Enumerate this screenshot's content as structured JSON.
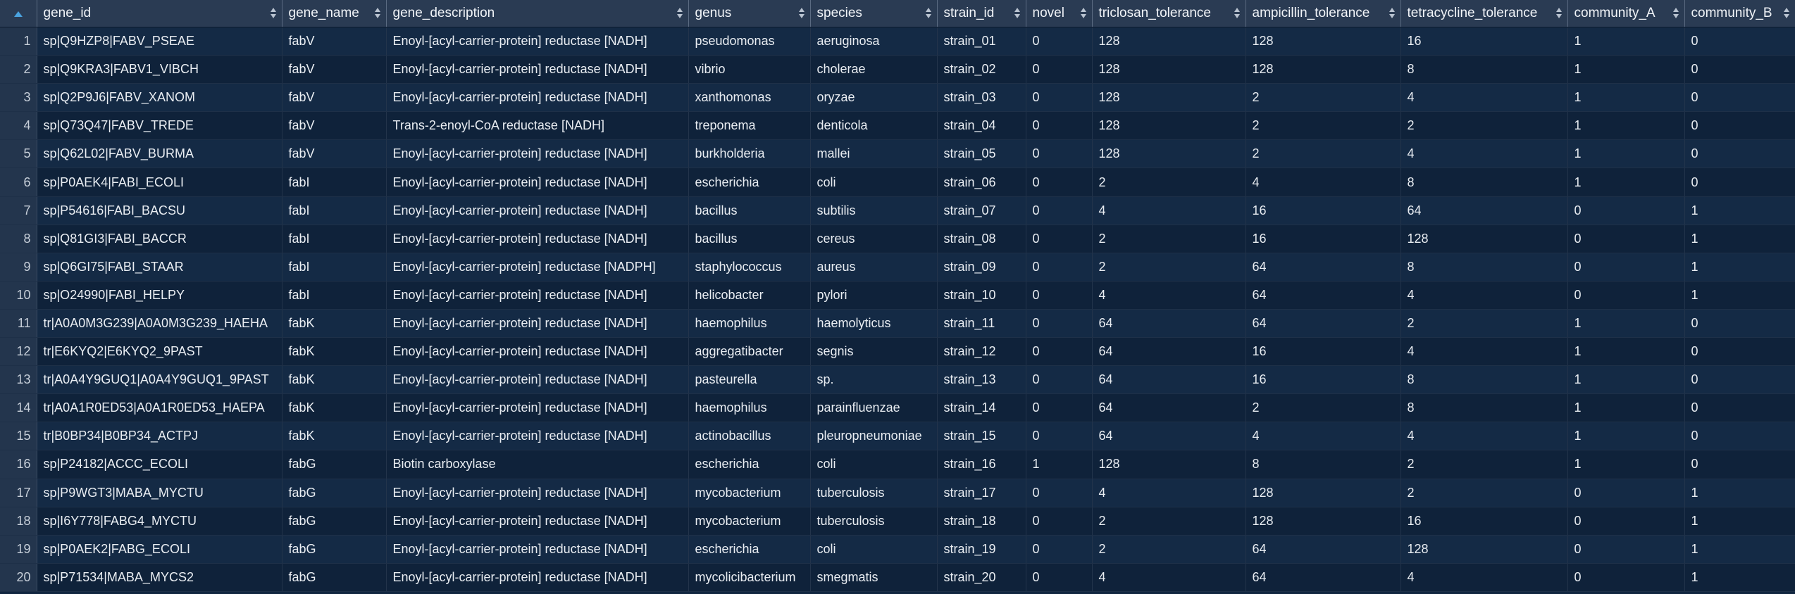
{
  "columns": [
    {
      "key": "gene_id",
      "label": "gene_id"
    },
    {
      "key": "gene_name",
      "label": "gene_name"
    },
    {
      "key": "gene_description",
      "label": "gene_description"
    },
    {
      "key": "genus",
      "label": "genus"
    },
    {
      "key": "species",
      "label": "species"
    },
    {
      "key": "strain_id",
      "label": "strain_id"
    },
    {
      "key": "novel",
      "label": "novel"
    },
    {
      "key": "triclosan_tolerance",
      "label": "triclosan_tolerance"
    },
    {
      "key": "ampicillin_tolerance",
      "label": "ampicillin_tolerance"
    },
    {
      "key": "tetracycline_tolerance",
      "label": "tetracycline_tolerance"
    },
    {
      "key": "community_A",
      "label": "community_A"
    },
    {
      "key": "community_B",
      "label": "community_B"
    }
  ],
  "rows": [
    {
      "n": "1",
      "gene_id": "sp|Q9HZP8|FABV_PSEAE",
      "gene_name": "fabV",
      "gene_description": "Enoyl-[acyl-carrier-protein] reductase [NADH]",
      "genus": "pseudomonas",
      "species": "aeruginosa",
      "strain_id": "strain_01",
      "novel": "0",
      "triclosan_tolerance": "128",
      "ampicillin_tolerance": "128",
      "tetracycline_tolerance": "16",
      "community_A": "1",
      "community_B": "0"
    },
    {
      "n": "2",
      "gene_id": "sp|Q9KRA3|FABV1_VIBCH",
      "gene_name": "fabV",
      "gene_description": "Enoyl-[acyl-carrier-protein] reductase [NADH]",
      "genus": "vibrio",
      "species": "cholerae",
      "strain_id": "strain_02",
      "novel": "0",
      "triclosan_tolerance": "128",
      "ampicillin_tolerance": "128",
      "tetracycline_tolerance": "8",
      "community_A": "1",
      "community_B": "0"
    },
    {
      "n": "3",
      "gene_id": "sp|Q2P9J6|FABV_XANOM",
      "gene_name": "fabV",
      "gene_description": "Enoyl-[acyl-carrier-protein] reductase [NADH]",
      "genus": "xanthomonas",
      "species": "oryzae",
      "strain_id": "strain_03",
      "novel": "0",
      "triclosan_tolerance": "128",
      "ampicillin_tolerance": "2",
      "tetracycline_tolerance": "4",
      "community_A": "1",
      "community_B": "0"
    },
    {
      "n": "4",
      "gene_id": "sp|Q73Q47|FABV_TREDE",
      "gene_name": "fabV",
      "gene_description": "Trans-2-enoyl-CoA reductase [NADH]",
      "genus": "treponema",
      "species": "denticola",
      "strain_id": "strain_04",
      "novel": "0",
      "triclosan_tolerance": "128",
      "ampicillin_tolerance": "2",
      "tetracycline_tolerance": "2",
      "community_A": "1",
      "community_B": "0"
    },
    {
      "n": "5",
      "gene_id": "sp|Q62L02|FABV_BURMA",
      "gene_name": "fabV",
      "gene_description": "Enoyl-[acyl-carrier-protein] reductase [NADH]",
      "genus": "burkholderia",
      "species": "mallei",
      "strain_id": "strain_05",
      "novel": "0",
      "triclosan_tolerance": "128",
      "ampicillin_tolerance": "2",
      "tetracycline_tolerance": "4",
      "community_A": "1",
      "community_B": "0"
    },
    {
      "n": "6",
      "gene_id": "sp|P0AEK4|FABI_ECOLI",
      "gene_name": "fabI",
      "gene_description": "Enoyl-[acyl-carrier-protein] reductase [NADH]",
      "genus": "escherichia",
      "species": "coli",
      "strain_id": "strain_06",
      "novel": "0",
      "triclosan_tolerance": "2",
      "ampicillin_tolerance": "4",
      "tetracycline_tolerance": "8",
      "community_A": "1",
      "community_B": "0"
    },
    {
      "n": "7",
      "gene_id": "sp|P54616|FABI_BACSU",
      "gene_name": "fabI",
      "gene_description": "Enoyl-[acyl-carrier-protein] reductase [NADH]",
      "genus": "bacillus",
      "species": "subtilis",
      "strain_id": "strain_07",
      "novel": "0",
      "triclosan_tolerance": "4",
      "ampicillin_tolerance": "16",
      "tetracycline_tolerance": "64",
      "community_A": "0",
      "community_B": "1"
    },
    {
      "n": "8",
      "gene_id": "sp|Q81GI3|FABI_BACCR",
      "gene_name": "fabI",
      "gene_description": "Enoyl-[acyl-carrier-protein] reductase [NADH]",
      "genus": "bacillus",
      "species": "cereus",
      "strain_id": "strain_08",
      "novel": "0",
      "triclosan_tolerance": "2",
      "ampicillin_tolerance": "16",
      "tetracycline_tolerance": "128",
      "community_A": "0",
      "community_B": "1"
    },
    {
      "n": "9",
      "gene_id": "sp|Q6GI75|FABI_STAAR",
      "gene_name": "fabI",
      "gene_description": "Enoyl-[acyl-carrier-protein] reductase [NADPH]",
      "genus": "staphylococcus",
      "species": "aureus",
      "strain_id": "strain_09",
      "novel": "0",
      "triclosan_tolerance": "2",
      "ampicillin_tolerance": "64",
      "tetracycline_tolerance": "8",
      "community_A": "0",
      "community_B": "1"
    },
    {
      "n": "10",
      "gene_id": "sp|O24990|FABI_HELPY",
      "gene_name": "fabI",
      "gene_description": "Enoyl-[acyl-carrier-protein] reductase [NADH]",
      "genus": "helicobacter",
      "species": "pylori",
      "strain_id": "strain_10",
      "novel": "0",
      "triclosan_tolerance": "4",
      "ampicillin_tolerance": "64",
      "tetracycline_tolerance": "4",
      "community_A": "0",
      "community_B": "1"
    },
    {
      "n": "11",
      "gene_id": "tr|A0A0M3G239|A0A0M3G239_HAEHA",
      "gene_name": "fabK",
      "gene_description": "Enoyl-[acyl-carrier-protein] reductase [NADH]",
      "genus": "haemophilus",
      "species": "haemolyticus",
      "strain_id": "strain_11",
      "novel": "0",
      "triclosan_tolerance": "64",
      "ampicillin_tolerance": "64",
      "tetracycline_tolerance": "2",
      "community_A": "1",
      "community_B": "0"
    },
    {
      "n": "12",
      "gene_id": "tr|E6KYQ2|E6KYQ2_9PAST",
      "gene_name": "fabK",
      "gene_description": "Enoyl-[acyl-carrier-protein] reductase [NADH]",
      "genus": "aggregatibacter",
      "species": "segnis",
      "strain_id": "strain_12",
      "novel": "0",
      "triclosan_tolerance": "64",
      "ampicillin_tolerance": "16",
      "tetracycline_tolerance": "4",
      "community_A": "1",
      "community_B": "0"
    },
    {
      "n": "13",
      "gene_id": "tr|A0A4Y9GUQ1|A0A4Y9GUQ1_9PAST",
      "gene_name": "fabK",
      "gene_description": "Enoyl-[acyl-carrier-protein] reductase [NADH]",
      "genus": "pasteurella",
      "species": "sp.",
      "strain_id": "strain_13",
      "novel": "0",
      "triclosan_tolerance": "64",
      "ampicillin_tolerance": "16",
      "tetracycline_tolerance": "8",
      "community_A": "1",
      "community_B": "0"
    },
    {
      "n": "14",
      "gene_id": "tr|A0A1R0ED53|A0A1R0ED53_HAEPA",
      "gene_name": "fabK",
      "gene_description": "Enoyl-[acyl-carrier-protein] reductase [NADH]",
      "genus": "haemophilus",
      "species": "parainfluenzae",
      "strain_id": "strain_14",
      "novel": "0",
      "triclosan_tolerance": "64",
      "ampicillin_tolerance": "2",
      "tetracycline_tolerance": "8",
      "community_A": "1",
      "community_B": "0"
    },
    {
      "n": "15",
      "gene_id": "tr|B0BP34|B0BP34_ACTPJ",
      "gene_name": "fabK",
      "gene_description": "Enoyl-[acyl-carrier-protein] reductase [NADH]",
      "genus": "actinobacillus",
      "species": "pleuropneumoniae",
      "strain_id": "strain_15",
      "novel": "0",
      "triclosan_tolerance": "64",
      "ampicillin_tolerance": "4",
      "tetracycline_tolerance": "4",
      "community_A": "1",
      "community_B": "0"
    },
    {
      "n": "16",
      "gene_id": "sp|P24182|ACCC_ECOLI",
      "gene_name": "fabG",
      "gene_description": "Biotin carboxylase",
      "genus": "escherichia",
      "species": "coli",
      "strain_id": "strain_16",
      "novel": "1",
      "triclosan_tolerance": "128",
      "ampicillin_tolerance": "8",
      "tetracycline_tolerance": "2",
      "community_A": "1",
      "community_B": "0"
    },
    {
      "n": "17",
      "gene_id": "sp|P9WGT3|MABA_MYCTU",
      "gene_name": "fabG",
      "gene_description": "Enoyl-[acyl-carrier-protein] reductase [NADH]",
      "genus": "mycobacterium",
      "species": "tuberculosis",
      "strain_id": "strain_17",
      "novel": "0",
      "triclosan_tolerance": "4",
      "ampicillin_tolerance": "128",
      "tetracycline_tolerance": "2",
      "community_A": "0",
      "community_B": "1"
    },
    {
      "n": "18",
      "gene_id": "sp|I6Y778|FABG4_MYCTU",
      "gene_name": "fabG",
      "gene_description": "Enoyl-[acyl-carrier-protein] reductase [NADH]",
      "genus": "mycobacterium",
      "species": "tuberculosis",
      "strain_id": "strain_18",
      "novel": "0",
      "triclosan_tolerance": "2",
      "ampicillin_tolerance": "128",
      "tetracycline_tolerance": "16",
      "community_A": "0",
      "community_B": "1"
    },
    {
      "n": "19",
      "gene_id": "sp|P0AEK2|FABG_ECOLI",
      "gene_name": "fabG",
      "gene_description": "Enoyl-[acyl-carrier-protein] reductase [NADH]",
      "genus": "escherichia",
      "species": "coli",
      "strain_id": "strain_19",
      "novel": "0",
      "triclosan_tolerance": "2",
      "ampicillin_tolerance": "64",
      "tetracycline_tolerance": "128",
      "community_A": "0",
      "community_B": "1"
    },
    {
      "n": "20",
      "gene_id": "sp|P71534|MABA_MYCS2",
      "gene_name": "fabG",
      "gene_description": "Enoyl-[acyl-carrier-protein] reductase [NADH]",
      "genus": "mycolicibacterium",
      "species": "smegmatis",
      "strain_id": "strain_20",
      "novel": "0",
      "triclosan_tolerance": "4",
      "ampicillin_tolerance": "64",
      "tetracycline_tolerance": "4",
      "community_A": "0",
      "community_B": "1"
    }
  ]
}
